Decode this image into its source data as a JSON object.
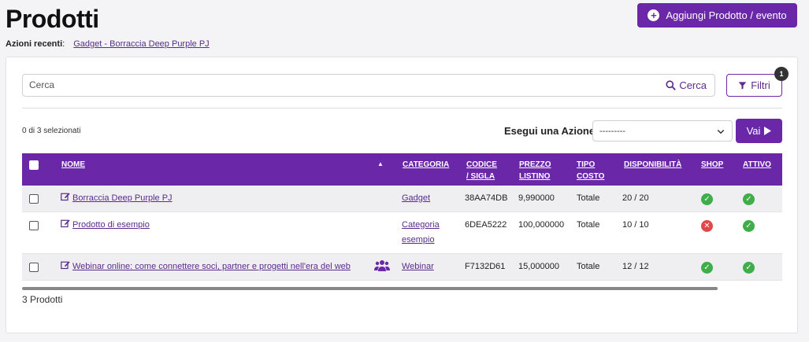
{
  "header": {
    "title": "Prodotti",
    "recent_label": "Azioni recenti",
    "recent_sep": ":",
    "recent_link": "Gadget - Borraccia Deep Purple PJ",
    "add_button": "Aggiungi Prodotto / evento"
  },
  "search": {
    "placeholder": "Cerca",
    "button": "Cerca"
  },
  "filters": {
    "label": "Filtri",
    "badge": "1"
  },
  "actions": {
    "selected": "0 di 3 selezionati",
    "label": "Esegui una Azione:",
    "select_value": "---------",
    "go": "Vai"
  },
  "table": {
    "headers": {
      "nome": "NOME",
      "categoria": "CATEGORIA",
      "codice_1": "CODICE",
      "codice_2": "/ SIGLA",
      "prezzo_1": "PREZZO",
      "prezzo_2": "LISTINO",
      "tipo_1": "TIPO",
      "tipo_2": "COSTO",
      "disp": "DISPONIBILITÀ",
      "shop": "SHOP",
      "attivo": "ATTIVO"
    },
    "rows": [
      {
        "nome": "Borraccia Deep Purple PJ",
        "categoria": "Gadget",
        "categoria_2": "",
        "codice": "38AA74DB",
        "prezzo": "9,990000",
        "tipo": "Totale",
        "disp": "20 / 20",
        "shop": true,
        "attivo": true
      },
      {
        "nome": "Prodotto di esempio",
        "categoria": "Categoria",
        "categoria_2": "esempio",
        "codice": "6DEA5222",
        "prezzo": "100,000000",
        "tipo": "Totale",
        "disp": "10 / 10",
        "shop": false,
        "attivo": true
      },
      {
        "nome": "Webinar online: come connettere soci, partner e progetti nell'era del web",
        "categoria": "Webinar",
        "categoria_2": "",
        "codice": "F7132D61",
        "prezzo": "15,000000",
        "tipo": "Totale",
        "disp": "12 / 12",
        "shop": true,
        "attivo": true
      }
    ]
  },
  "footer": {
    "total": "3 Prodotti"
  },
  "icons": {
    "edit": "edit-icon",
    "ok": "check-circle-icon",
    "ko": "x-circle-icon",
    "users": "users-icon",
    "filter": "filter-icon",
    "search": "search-icon",
    "play": "play-icon",
    "plus": "plus-circle-icon"
  },
  "colors": {
    "accent": "#6a27a8",
    "ok": "#3fae49",
    "ko": "#e04848"
  }
}
